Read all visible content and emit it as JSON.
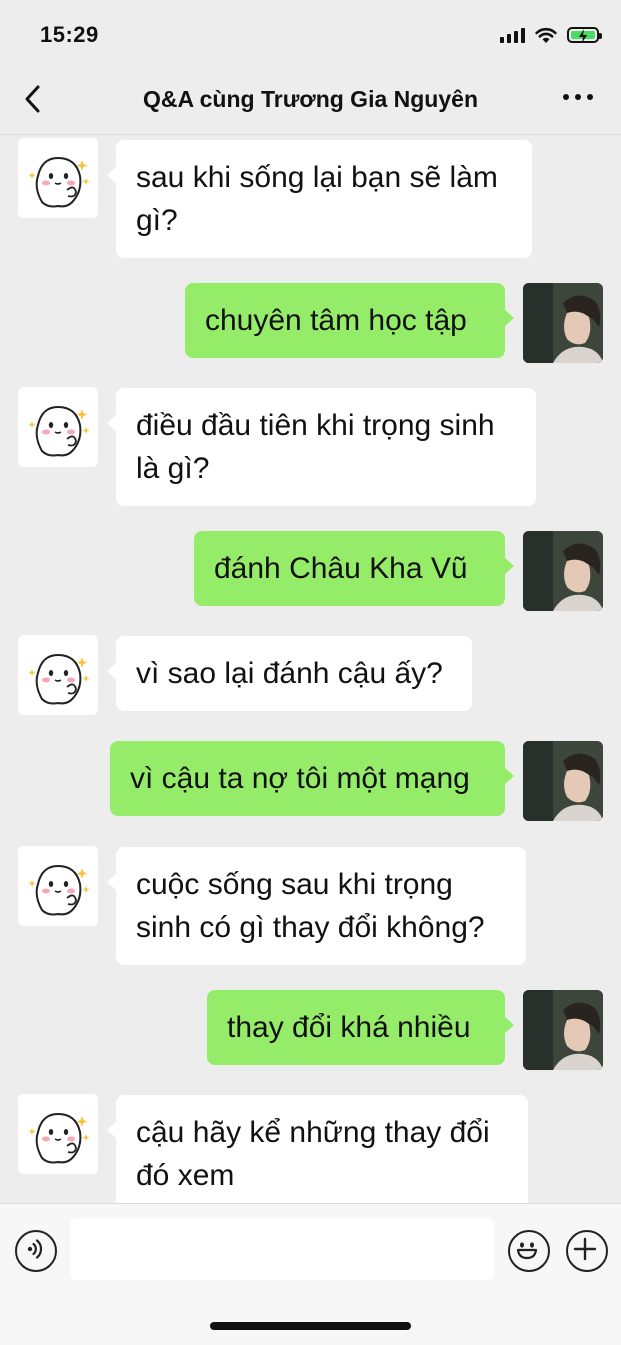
{
  "status_bar": {
    "time": "15:29",
    "battery_color": "#4CD964"
  },
  "header": {
    "title": "Q&A cùng Trương Gia Nguyên",
    "back_icon": "chevron-left-icon",
    "more_icon": "more-dots-icon"
  },
  "messages": [
    {
      "side": "in",
      "text": "sau khi sống lại bạn sẽ làm gì?"
    },
    {
      "side": "out",
      "text": "chuyên tâm học tập"
    },
    {
      "side": "in",
      "text": "điều đầu tiên khi trọng sinh là gì?"
    },
    {
      "side": "out",
      "text": "đánh Châu Kha Vũ"
    },
    {
      "side": "in",
      "text": "vì sao lại đánh cậu ấy?"
    },
    {
      "side": "out",
      "text": "vì cậu ta nợ tôi một mạng"
    },
    {
      "side": "in",
      "text": "cuộc sống sau khi trọng sinh có gì thay đổi không?"
    },
    {
      "side": "out",
      "text": "thay đổi khá nhiều"
    },
    {
      "side": "in",
      "text": "cậu hãy kể những thay đổi đó xem"
    }
  ],
  "composer": {
    "input_value": "",
    "input_placeholder": "",
    "voice_icon": "voice-icon",
    "emoji_icon": "emoji-icon",
    "plus_icon": "plus-icon"
  },
  "colors": {
    "background": "#EDEDED",
    "incoming_bubble": "#FFFFFF",
    "outgoing_bubble": "#95EC69"
  }
}
